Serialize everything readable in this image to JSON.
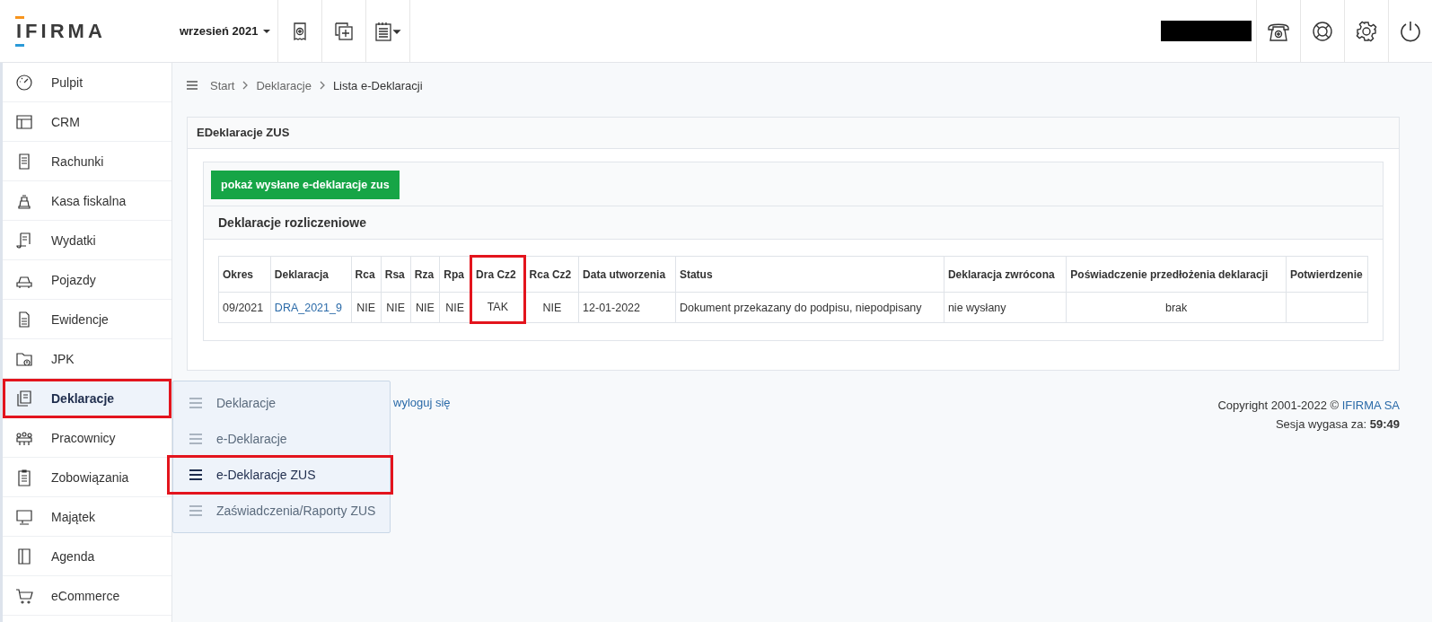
{
  "header": {
    "logo": "IFIRMA",
    "period": "wrzesień 2021"
  },
  "sidebar": {
    "items": [
      {
        "label": "Pulpit",
        "selected": false,
        "highlighted": false
      },
      {
        "label": "CRM",
        "selected": false,
        "highlighted": false
      },
      {
        "label": "Rachunki",
        "selected": false,
        "highlighted": false
      },
      {
        "label": "Kasa fiskalna",
        "selected": false,
        "highlighted": false
      },
      {
        "label": "Wydatki",
        "selected": false,
        "highlighted": false
      },
      {
        "label": "Pojazdy",
        "selected": false,
        "highlighted": false
      },
      {
        "label": "Ewidencje",
        "selected": false,
        "highlighted": false
      },
      {
        "label": "JPK",
        "selected": false,
        "highlighted": false
      },
      {
        "label": "Deklaracje",
        "selected": true,
        "highlighted": true
      },
      {
        "label": "Pracownicy",
        "selected": false,
        "highlighted": false
      },
      {
        "label": "Zobowiązania",
        "selected": false,
        "highlighted": false
      },
      {
        "label": "Majątek",
        "selected": false,
        "highlighted": false
      },
      {
        "label": "Agenda",
        "selected": false,
        "highlighted": false
      },
      {
        "label": "eCommerce",
        "selected": false,
        "highlighted": false
      }
    ]
  },
  "submenu": {
    "items": [
      {
        "label": "Deklaracje",
        "selected": false,
        "highlighted": false
      },
      {
        "label": "e-Deklaracje",
        "selected": false,
        "highlighted": false
      },
      {
        "label": "e-Deklaracje ZUS",
        "selected": true,
        "highlighted": true
      },
      {
        "label": "Zaświadczenia/Raporty ZUS",
        "selected": false,
        "highlighted": false
      }
    ]
  },
  "breadcrumb": [
    "Start",
    "Deklaracje",
    "Lista e-Deklaracji"
  ],
  "card": {
    "title": "EDeklaracje ZUS",
    "button": "pokaż wysłane e-deklaracje zus",
    "section_title": "Deklaracje rozliczeniowe"
  },
  "table": {
    "columns": [
      {
        "label": "Okres",
        "kind": "text",
        "highlighted": false
      },
      {
        "label": "Deklaracja",
        "kind": "link",
        "highlighted": false
      },
      {
        "label": "Rca",
        "kind": "flag",
        "highlighted": false
      },
      {
        "label": "Rsa",
        "kind": "flag",
        "highlighted": false
      },
      {
        "label": "Rza",
        "kind": "flag",
        "highlighted": false
      },
      {
        "label": "Rpa",
        "kind": "flag",
        "highlighted": false
      },
      {
        "label": "Dra Cz2",
        "kind": "flag",
        "highlighted": true
      },
      {
        "label": "Rca Cz2",
        "kind": "flag",
        "highlighted": false
      },
      {
        "label": "Data utworzenia",
        "kind": "text",
        "highlighted": false
      },
      {
        "label": "Status",
        "kind": "text",
        "highlighted": false
      },
      {
        "label": "Deklaracja zwrócona",
        "kind": "text",
        "highlighted": false
      },
      {
        "label": "Poświadczenie przedłożenia deklaracji",
        "kind": "flag",
        "highlighted": false
      },
      {
        "label": "Potwierdzenie",
        "kind": "text",
        "highlighted": false
      }
    ],
    "rows": [
      [
        "09/2021",
        "DRA_2021_9",
        "NIE",
        "NIE",
        "NIE",
        "NIE",
        "TAK",
        "NIE",
        "12-01-2022",
        "Dokument przekazany do podpisu, niepodpisany",
        "nie wysłany",
        "brak",
        ""
      ]
    ]
  },
  "footer": {
    "logout": "wyloguj się",
    "copyright": "Copyright 2001-2022 ©",
    "company": "IFIRMA SA",
    "session_label": "Sesja wygasa za:",
    "session_time": "59:49"
  }
}
